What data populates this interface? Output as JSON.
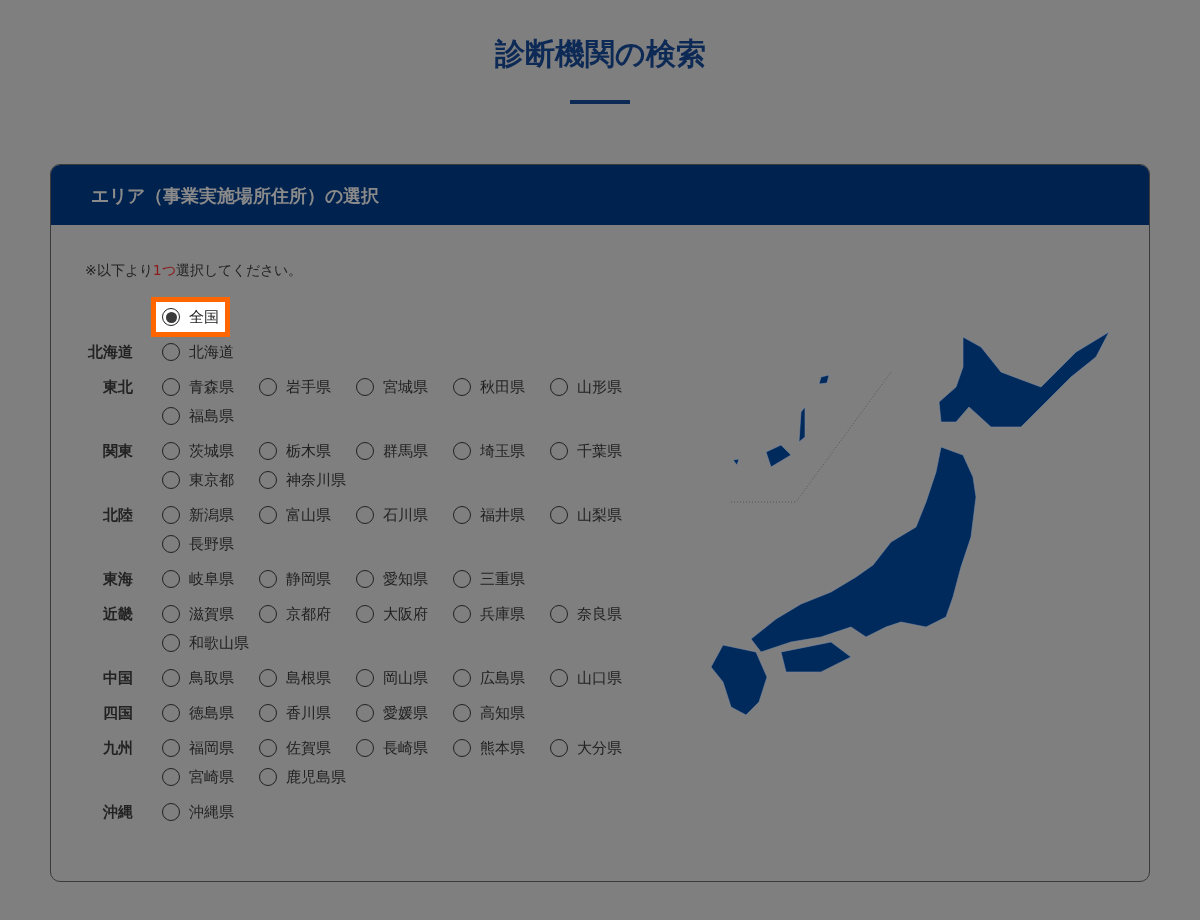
{
  "title": "診断機関の検索",
  "panel": {
    "heading": "エリア（事業実施場所住所）の選択",
    "note": {
      "before": "※以下より",
      "emphasis": "1つ",
      "after": "選択してください。"
    },
    "nationwide": {
      "label": "全国",
      "selected": true,
      "highlighted": true
    },
    "regions": [
      {
        "name": "北海道",
        "prefectures": [
          {
            "label": "北海道",
            "selected": false
          }
        ]
      },
      {
        "name": "東北",
        "prefectures": [
          {
            "label": "青森県",
            "selected": false
          },
          {
            "label": "岩手県",
            "selected": false
          },
          {
            "label": "宮城県",
            "selected": false
          },
          {
            "label": "秋田県",
            "selected": false
          },
          {
            "label": "山形県",
            "selected": false
          },
          {
            "label": "福島県",
            "selected": false
          }
        ]
      },
      {
        "name": "関東",
        "prefectures": [
          {
            "label": "茨城県",
            "selected": false
          },
          {
            "label": "栃木県",
            "selected": false
          },
          {
            "label": "群馬県",
            "selected": false
          },
          {
            "label": "埼玉県",
            "selected": false
          },
          {
            "label": "千葉県",
            "selected": false
          },
          {
            "label": "東京都",
            "selected": false
          },
          {
            "label": "神奈川県",
            "selected": false
          }
        ]
      },
      {
        "name": "北陸",
        "prefectures": [
          {
            "label": "新潟県",
            "selected": false
          },
          {
            "label": "富山県",
            "selected": false
          },
          {
            "label": "石川県",
            "selected": false
          },
          {
            "label": "福井県",
            "selected": false
          },
          {
            "label": "山梨県",
            "selected": false
          },
          {
            "label": "長野県",
            "selected": false
          }
        ]
      },
      {
        "name": "東海",
        "prefectures": [
          {
            "label": "岐阜県",
            "selected": false
          },
          {
            "label": "静岡県",
            "selected": false
          },
          {
            "label": "愛知県",
            "selected": false
          },
          {
            "label": "三重県",
            "selected": false
          }
        ]
      },
      {
        "name": "近畿",
        "prefectures": [
          {
            "label": "滋賀県",
            "selected": false
          },
          {
            "label": "京都府",
            "selected": false
          },
          {
            "label": "大阪府",
            "selected": false
          },
          {
            "label": "兵庫県",
            "selected": false
          },
          {
            "label": "奈良県",
            "selected": false
          },
          {
            "label": "和歌山県",
            "selected": false
          }
        ]
      },
      {
        "name": "中国",
        "prefectures": [
          {
            "label": "鳥取県",
            "selected": false
          },
          {
            "label": "島根県",
            "selected": false
          },
          {
            "label": "岡山県",
            "selected": false
          },
          {
            "label": "広島県",
            "selected": false
          },
          {
            "label": "山口県",
            "selected": false
          }
        ]
      },
      {
        "name": "四国",
        "prefectures": [
          {
            "label": "徳島県",
            "selected": false
          },
          {
            "label": "香川県",
            "selected": false
          },
          {
            "label": "愛媛県",
            "selected": false
          },
          {
            "label": "高知県",
            "selected": false
          }
        ]
      },
      {
        "name": "九州",
        "prefectures": [
          {
            "label": "福岡県",
            "selected": false
          },
          {
            "label": "佐賀県",
            "selected": false
          },
          {
            "label": "長崎県",
            "selected": false
          },
          {
            "label": "熊本県",
            "selected": false
          },
          {
            "label": "大分県",
            "selected": false
          },
          {
            "label": "宮崎県",
            "selected": false
          },
          {
            "label": "鹿児島県",
            "selected": false
          }
        ]
      },
      {
        "name": "沖縄",
        "prefectures": [
          {
            "label": "沖縄県",
            "selected": false
          }
        ]
      }
    ]
  }
}
